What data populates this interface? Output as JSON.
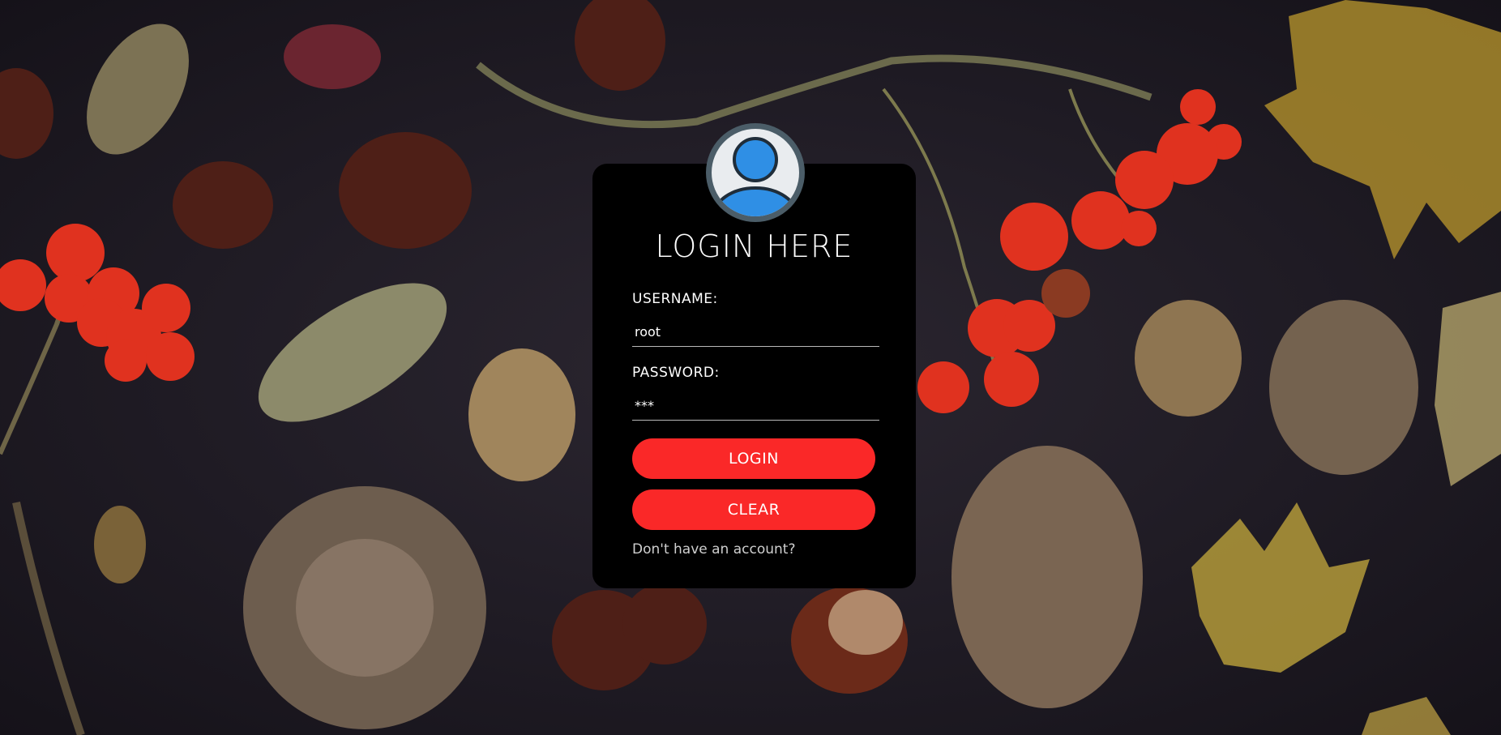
{
  "page": {
    "title": "LOGIN HERE"
  },
  "form": {
    "username_label": "USERNAME:",
    "username_value": "root",
    "password_label": "PASSWORD:",
    "password_value": "***",
    "login_label": "LOGIN",
    "clear_label": "CLEAR",
    "signup_link": "Don't have an account?"
  },
  "icons": {
    "avatar": "user-avatar-icon"
  },
  "colors": {
    "button": "#fa2828",
    "card": "#000000",
    "avatar_blue": "#2f8fe5",
    "avatar_ring": "#4b5d68"
  }
}
